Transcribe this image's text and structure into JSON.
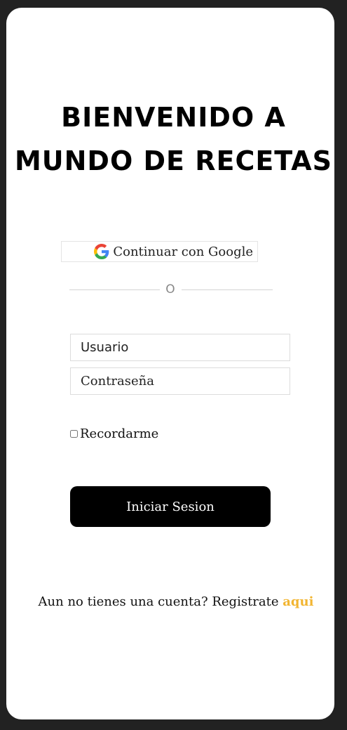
{
  "title": {
    "line1": "BIENVENIDO A",
    "line2": "MUNDO DE RECETAS"
  },
  "google_button": {
    "icon": "google-g-icon",
    "label": "Continuar con Google"
  },
  "divider": {
    "text": "O"
  },
  "form": {
    "username_placeholder": "Usuario",
    "password_placeholder": "Contraseña",
    "remember_label": "Recordarme",
    "remember_checked": false,
    "submit_label": "Iniciar Sesion"
  },
  "register": {
    "prompt": "Aun no tienes una cuenta? Registrate ",
    "link_label": "aqui"
  },
  "colors": {
    "background": "#222222",
    "card": "#ffffff",
    "button": "#000000",
    "link": "#f2b531"
  }
}
